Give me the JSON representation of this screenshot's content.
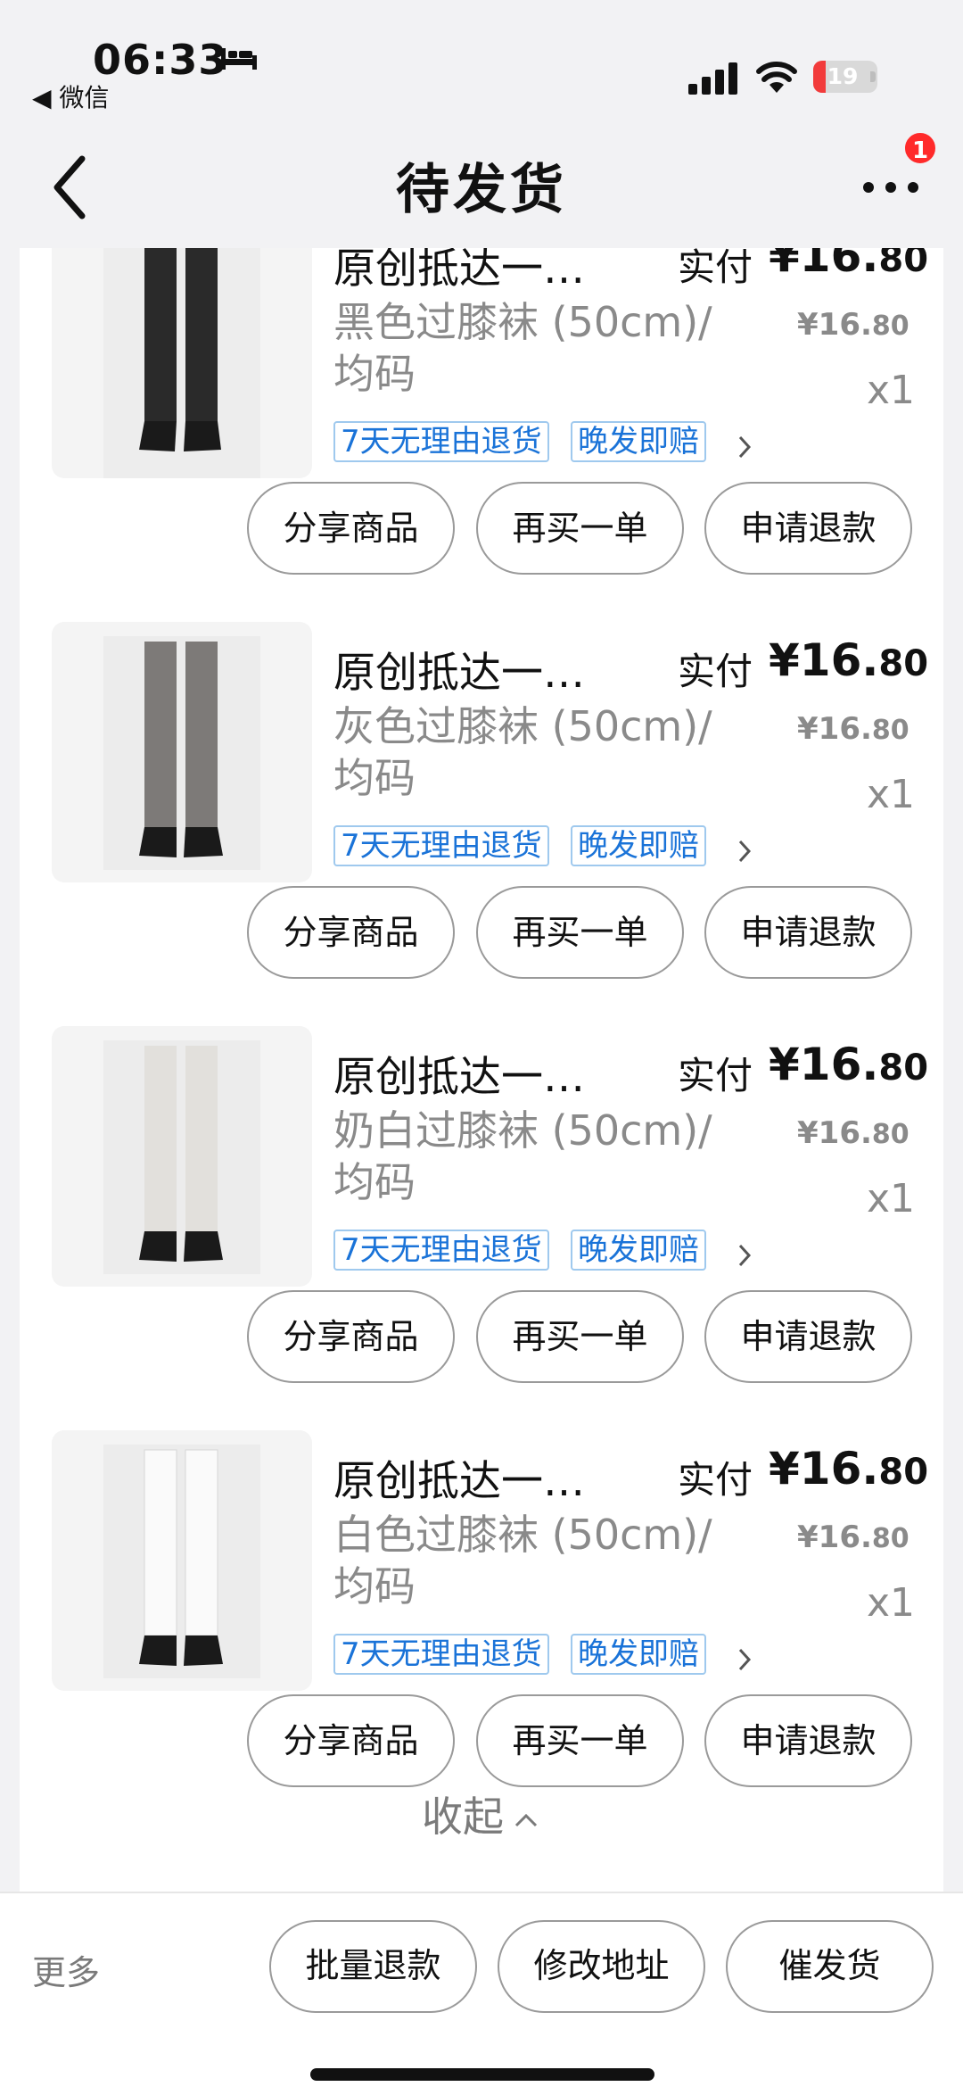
{
  "status_bar": {
    "time": "06:33",
    "back_app": "◀ 微信",
    "battery": "19",
    "battery_color": "#f23b3b"
  },
  "nav": {
    "title": "待发货",
    "badge": "1"
  },
  "items": [
    {
      "title": "原创抵达一…",
      "paid_label": "实付",
      "paid_price_main": "¥16.",
      "paid_price_small": "80",
      "sku_line1": "黑色过膝袜 (50cm)/",
      "sku_line2": "均码",
      "unit_price_main": "¥16.",
      "unit_price_small": "80",
      "qty": "x1",
      "tag1": "7天无理由退货",
      "tag2": "晚发即赔",
      "sock_color": "#2a2a2a",
      "btn_share": "分享商品",
      "btn_rebuy": "再买一单",
      "btn_refund": "申请退款"
    },
    {
      "title": "原创抵达一…",
      "paid_label": "实付",
      "paid_price_main": "¥16.",
      "paid_price_small": "80",
      "sku_line1": "灰色过膝袜 (50cm)/",
      "sku_line2": "均码",
      "unit_price_main": "¥16.",
      "unit_price_small": "80",
      "qty": "x1",
      "tag1": "7天无理由退货",
      "tag2": "晚发即赔",
      "sock_color": "#7d7a78",
      "btn_share": "分享商品",
      "btn_rebuy": "再买一单",
      "btn_refund": "申请退款"
    },
    {
      "title": "原创抵达一…",
      "paid_label": "实付",
      "paid_price_main": "¥16.",
      "paid_price_small": "80",
      "sku_line1": "奶白过膝袜 (50cm)/",
      "sku_line2": "均码",
      "unit_price_main": "¥16.",
      "unit_price_small": "80",
      "qty": "x1",
      "tag1": "7天无理由退货",
      "tag2": "晚发即赔",
      "sock_color": "#eceae6",
      "btn_share": "分享商品",
      "btn_rebuy": "再买一单",
      "btn_refund": "申请退款"
    },
    {
      "title": "原创抵达一…",
      "paid_label": "实付",
      "paid_price_main": "¥16.",
      "paid_price_small": "80",
      "sku_line1": "白色过膝袜 (50cm)/",
      "sku_line2": "均码",
      "unit_price_main": "¥16.",
      "unit_price_small": "80",
      "qty": "x1",
      "tag1": "7天无理由退货",
      "tag2": "晚发即赔",
      "sock_color": "#f7f7f7",
      "btn_share": "分享商品",
      "btn_rebuy": "再买一单",
      "btn_refund": "申请退款"
    }
  ],
  "collapse_label": "收起",
  "bottom_bar": {
    "more": "更多",
    "batch_refund": "批量退款",
    "change_address": "修改地址",
    "urge_ship": "催发货"
  }
}
